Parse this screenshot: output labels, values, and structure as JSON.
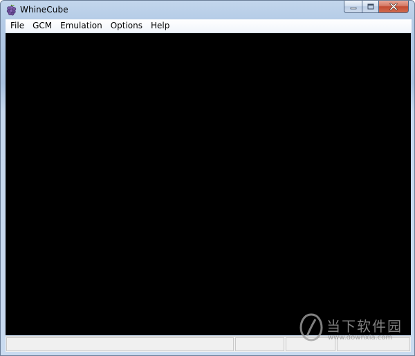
{
  "window": {
    "title": "WhineCube",
    "icon": "grape-icon"
  },
  "caption_buttons": [
    "minimize-icon",
    "maximize-icon",
    "close-icon"
  ],
  "menu": {
    "items": [
      {
        "label": "File"
      },
      {
        "label": "GCM"
      },
      {
        "label": "Emulation"
      },
      {
        "label": "Options"
      },
      {
        "label": "Help"
      }
    ]
  },
  "statusbar": {
    "panes": [
      "",
      "",
      "",
      ""
    ]
  },
  "watermark": {
    "text": "当下软件园",
    "url": "www.downxia.com"
  },
  "colors": {
    "canvas": "#000000",
    "close_button": "#c24b32"
  }
}
